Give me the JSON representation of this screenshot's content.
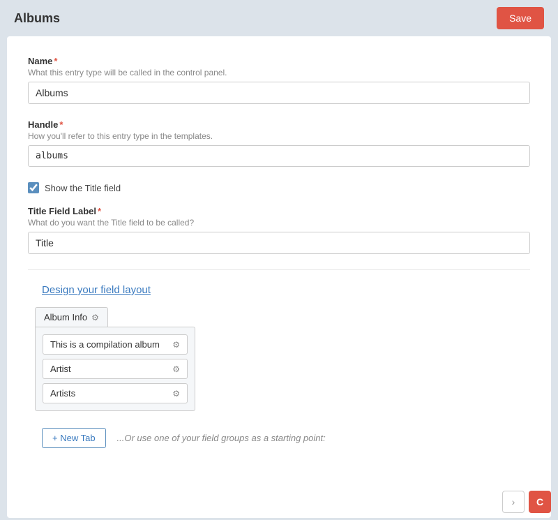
{
  "header": {
    "title": "Albums",
    "save_label": "Save"
  },
  "form": {
    "name_label": "Name",
    "name_hint": "What this entry type will be called in the control panel.",
    "name_value": "Albums",
    "handle_label": "Handle",
    "handle_hint": "How you'll refer to this entry type in the templates.",
    "handle_value": "albums",
    "show_title_label": "Show the Title field",
    "title_field_label": "Title Field Label",
    "title_field_hint": "What do you want the Title field to be called?",
    "title_field_value": "Title"
  },
  "field_layout": {
    "design_link": "Design your field layout",
    "tab_label": "Album Info",
    "fields": [
      {
        "label": "This is a compilation album"
      },
      {
        "label": "Artist"
      },
      {
        "label": "Artists"
      }
    ]
  },
  "bottom_bar": {
    "new_tab_label": "+ New Tab",
    "or_text": "...Or use one of your field groups as a starting point:"
  },
  "icons": {
    "gear": "⚙",
    "check": "✓",
    "plus": "+",
    "craft_c": "C",
    "chevron_right": "›"
  }
}
